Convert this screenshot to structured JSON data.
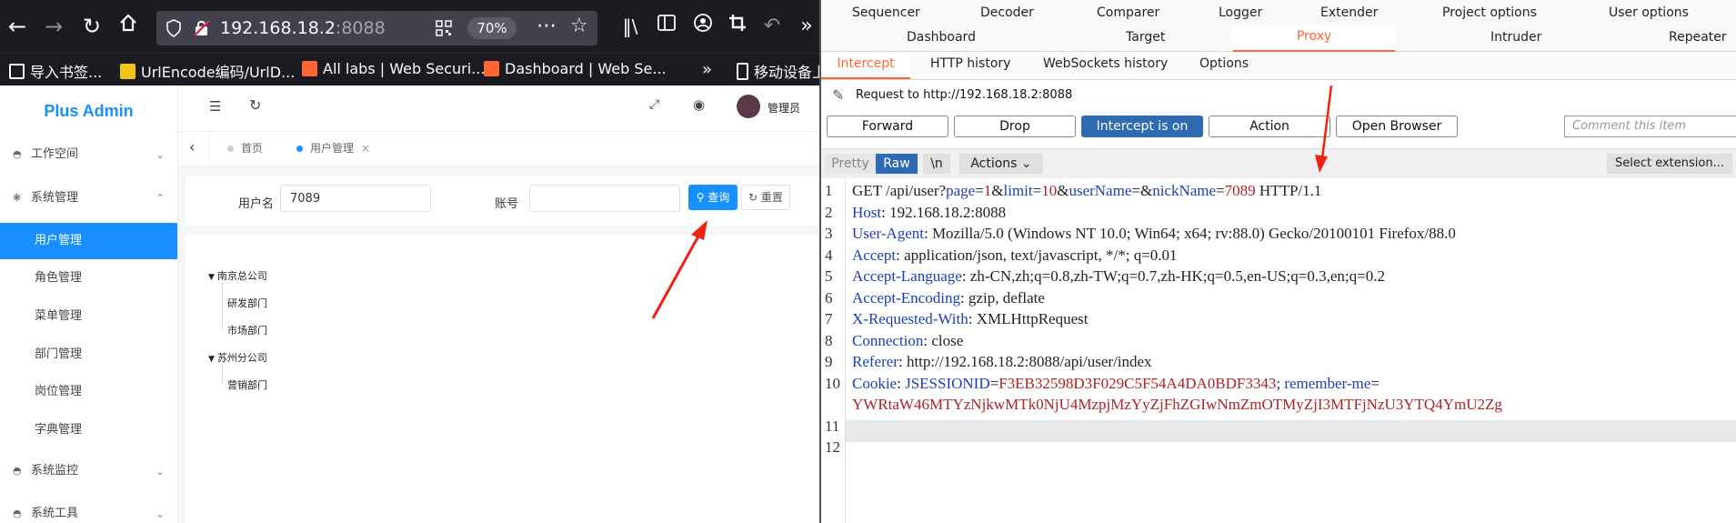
{
  "browser": {
    "url_host": "192.168.18.2",
    "url_port": ":8088",
    "zoom": "70%",
    "bookmarks": [
      {
        "label": "导入书签...",
        "color": "#9aa0a6"
      },
      {
        "label": "UrlEncode编码/UrlD...",
        "color": "#f0c419"
      },
      {
        "label": "All labs | Web Securi...",
        "color": "#ff6633"
      },
      {
        "label": "Dashboard | Web Se...",
        "color": "#ff6633"
      },
      {
        "label": "移动设备上",
        "color": "#9aa0a6"
      }
    ],
    "icons": [
      "back-icon",
      "forward-icon",
      "reload-icon",
      "home-icon",
      "shield-icon",
      "insecure-lock-icon",
      "qr-icon",
      "more-icon",
      "star-icon",
      "library-icon",
      "reader-icon",
      "account-icon",
      "crop-icon",
      "undo-icon",
      "overflow-icon"
    ]
  },
  "app": {
    "logo": "Plus Admin",
    "menu": [
      {
        "label": "工作空间",
        "expanded": false
      },
      {
        "label": "系统管理",
        "expanded": true,
        "children": [
          "用户管理",
          "角色管理",
          "菜单管理",
          "部门管理",
          "岗位管理",
          "字典管理"
        ],
        "active_child": "用户管理"
      },
      {
        "label": "系统监控",
        "expanded": false
      },
      {
        "label": "系统工具",
        "expanded": false
      }
    ],
    "user_name": "管理员",
    "tabs": [
      {
        "label": "首页",
        "active": false
      },
      {
        "label": "用户管理",
        "active": true
      }
    ],
    "search": {
      "username_label": "用户名",
      "username_value": "7089",
      "account_label": "账号",
      "account_value": "",
      "query_label": "查询",
      "reset_label": "重置"
    },
    "tree": [
      {
        "label": "南京总公司",
        "children": [
          "研发部门",
          "市场部门"
        ]
      },
      {
        "label": "苏州分公司",
        "children": [
          "营销部门"
        ]
      }
    ]
  },
  "burp": {
    "top_tabs_row1": [
      "Sequencer",
      "Decoder",
      "Comparer",
      "Logger",
      "Extender",
      "Project options",
      "User options"
    ],
    "top_tabs_row2": [
      "Dashboard",
      "Target",
      "Proxy",
      "Intruder",
      "Repeater"
    ],
    "active_top_tab": "Proxy",
    "proxy_tabs": [
      "Intercept",
      "HTTP history",
      "WebSockets history",
      "Options"
    ],
    "active_proxy_tab": "Intercept",
    "request_to": "Request to http://192.168.18.2:8088",
    "buttons": [
      "Forward",
      "Drop",
      "Intercept is on",
      "Action",
      "Open Browser"
    ],
    "comment_placeholder": "Comment this item",
    "editor_modes": {
      "pretty": "Pretty",
      "raw": "Raw",
      "newline": "\\n",
      "actions": "Actions",
      "select_extension": "Select extension..."
    },
    "lines": [
      "GET /api/user?page=1&limit=10&userName=&nickName=7089 HTTP/1.1",
      "Host: 192.168.18.2:8088",
      "User-Agent: Mozilla/5.0 (Windows NT 10.0; Win64; x64; rv:88.0) Gecko/20100101 Firefox/88.0",
      "Accept: application/json, text/javascript, */*; q=0.01",
      "Accept-Language: zh-CN,zh;q=0.8,zh-TW;q=0.7,zh-HK;q=0.5,en-US;q=0.3,en;q=0.2",
      "Accept-Encoding: gzip, deflate",
      "X-Requested-With: XMLHttpRequest",
      "Connection: close",
      "Referer: http://192.168.18.2:8088/api/user/index",
      "Cookie: JSESSIONID=F3EB32598D3F029C5F54A4DA0BDF3343; remember-me=",
      "YWRtaW46MTYzNjkwMTk0NjU4MzpjMzYyZjFhZGIwNmZmOTMyZjI3MTFjNzU3YTQ4YmU2Zg",
      "",
      ""
    ],
    "line_numbers": [
      "1",
      "2",
      "3",
      "4",
      "5",
      "6",
      "7",
      "8",
      "9",
      "10",
      "",
      "11",
      "12"
    ]
  },
  "colors": {
    "burp_accent": "#ff6633",
    "burp_blue": "#2f6bb5",
    "app_blue": "#1890ff",
    "annotation_arrow": "#ee2211"
  }
}
